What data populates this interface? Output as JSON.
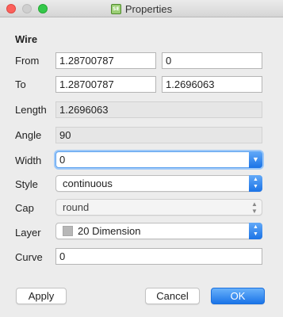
{
  "window": {
    "title": "Properties",
    "app_icon_text": "SE"
  },
  "section": {
    "heading": "Wire"
  },
  "form": {
    "from_label": "From",
    "from_x": "1.28700787",
    "from_y": "0",
    "to_label": "To",
    "to_x": "1.28700787",
    "to_y": "1.2696063",
    "length_label": "Length",
    "length_value": "1.2696063",
    "angle_label": "Angle",
    "angle_value": "90",
    "width_label": "Width",
    "width_value": "0",
    "style_label": "Style",
    "style_value": "continuous",
    "cap_label": "Cap",
    "cap_value": "round",
    "layer_label": "Layer",
    "layer_value": "20 Dimension",
    "curve_label": "Curve",
    "curve_value": "0"
  },
  "buttons": {
    "apply": "Apply",
    "cancel": "Cancel",
    "ok": "OK"
  },
  "colors": {
    "accent": "#1b74e8",
    "layer_swatch": "#b7b7b7",
    "close": "#fc605b",
    "maximize": "#34c84a"
  },
  "icons": {
    "dropdown": "chevron-down-icon",
    "updown": "updown-arrows-icon"
  }
}
